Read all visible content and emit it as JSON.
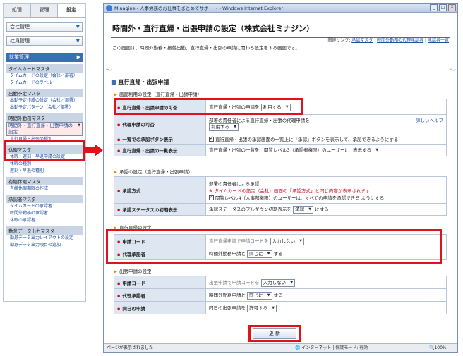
{
  "nav": {
    "tabs": [
      "処理",
      "管理",
      "設定"
    ],
    "company": "会社管理",
    "employee": "社員管理",
    "work": "就業管理",
    "sections": [
      {
        "title": "タイムカードマスタ",
        "links": [
          "タイムカードの設定（会社／部署）",
          "タイムカードのラベル"
        ]
      },
      {
        "title": "出勤予定マスタ",
        "links": [
          "出勤予定作成の設定（会社／部署）",
          "出勤予定パターン（会社／部署）"
        ]
      },
      {
        "title": "時間外勤務マスタ",
        "links": [
          "時間外・直行直帰・出張申請の設定",
          "直行直帰・出張の種別"
        ]
      },
      {
        "title": "休暇マスタ",
        "links": [
          "休暇・遅刻・早退申請の設定",
          "休暇の種別",
          "遅刻・早退の種別"
        ]
      },
      {
        "title": "有給休暇マスタ",
        "links": [
          "有給休暇期限の作成"
        ]
      },
      {
        "title": "承認者マスタ",
        "links": [
          "タイムカードの承認者",
          "時間外勤務の承認者",
          "休暇の承認者"
        ]
      },
      {
        "title": "勤怠データ出力マスタ",
        "links": [
          "勤怠データ出力レイアウトの設定",
          "勤怠データ出力項目の追加"
        ]
      }
    ]
  },
  "window": {
    "title": "Minagine - 人事労務のお仕事をまとめてサポート - Windows Internet Explorer",
    "buttons": [
      "_",
      "□",
      "X"
    ]
  },
  "page": {
    "title": "時間外・直行直帰・出張申請の設定（株式会社ミナジン）",
    "related_label": "関連リンク:",
    "related_links": [
      "承認マスタ",
      "時間外勤務の代理承認者",
      "承認者一覧"
    ],
    "intro": "この画面は、時間外勤務・振替出勤、直行直帰・出張の申請に関わる設定をする画面です。",
    "tear": "～"
  },
  "section": {
    "title": "直行直帰・出張申請",
    "usage_title": "画面利用の設定（直行直帰・出張申請）",
    "usage_rows": [
      {
        "label": "直行直帰・出張申請の可否",
        "prefix": "直行直帰・出張の申請を",
        "select": "利用する"
      },
      {
        "label": "代理申請の可否",
        "prefix": "部署の責任者による直行直帰・出張の代理申請を",
        "select": "利用する",
        "help": "詳しいヘルプ"
      },
      {
        "label": "一覧での承認ボタン表示",
        "text": "直行直帰・出張の承認画面の一覧上に「承認」ボタンを表示して、承認できるようにする"
      },
      {
        "label": "直行直帰・出張の一覧表示",
        "prefix": "直行直帰・出張の一覧を　閲覧レベル3（承認者権限）のユーザーに",
        "select": "表示する"
      }
    ],
    "approval_title": "承認の設定（直行直帰・出張申請）",
    "approval_rows": [
      {
        "label": "承認方式",
        "line1": "部署の責任者による承認",
        "warning": "※ タイムカードの設定（会社）画面の「承認方式」と同じ内容が表示されます",
        "line3": "閲覧レベル4（人事部権限）のユーザーは、すべての申請を承認できる ようにする"
      },
      {
        "label": "承認ステータスの初期表示",
        "prefix": "承認ステータスのプルダウン初期表示を",
        "select": "承認",
        "suffix": "にする"
      }
    ],
    "direct_title": "直行直帰の設定",
    "direct_rows": [
      {
        "label": "申請コード",
        "prefix": "直行直帰申請で申請コードを",
        "select": "入力しない"
      },
      {
        "label": "代理承認者",
        "prefix": "時間外勤務申請と",
        "select": "同じに",
        "suffix": "する"
      }
    ],
    "trip_title": "出張申請の設定",
    "trip_rows": [
      {
        "label": "申請コード",
        "prefix": "出張申請で申請コードを",
        "select": "入力しない"
      },
      {
        "label": "代理承認者",
        "prefix": "時間外勤務申請と",
        "select": "同じに",
        "suffix": "する"
      },
      {
        "label": "同日の申請",
        "prefix": "同日の出張申請を",
        "select": "許可する"
      }
    ],
    "submit": "更 新"
  },
  "status": {
    "left": "ページが表示されました",
    "mid": "インターネット | 保護モード: 有効",
    "zoom": "100%"
  },
  "colors": {
    "accent": "#3a6fb8",
    "highlight": "#e0121b",
    "label_bg": "#dde6f1"
  }
}
